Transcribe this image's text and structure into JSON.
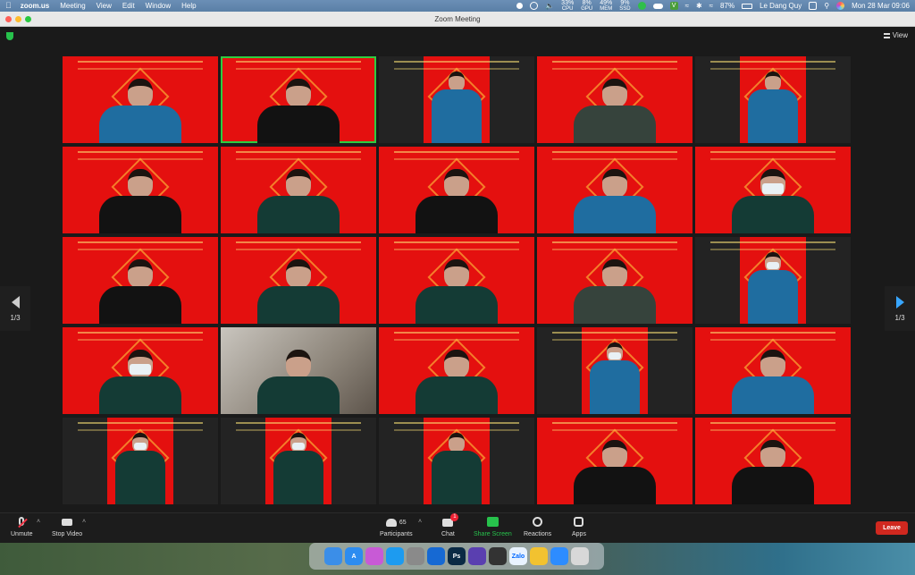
{
  "menubar": {
    "app_name": "zoom.us",
    "menus": [
      "Meeting",
      "View",
      "Edit",
      "Window",
      "Help"
    ],
    "stats": [
      {
        "value": "33%",
        "label": "CPU"
      },
      {
        "value": "8%",
        "label": "GPU"
      },
      {
        "value": "49%",
        "label": "MEM"
      },
      {
        "value": "9%",
        "label": "SSD"
      }
    ],
    "battery": "87%",
    "user": "Le Dang Quy",
    "datetime": "Mon 28 Mar  09:06"
  },
  "window": {
    "title": "Zoom Meeting"
  },
  "meeting": {
    "view_label": "View",
    "page_indicator_left": "1/3",
    "page_indicator_right": "1/3",
    "tiles": [
      {
        "bg": "red",
        "uniform": "blue",
        "layout": "full"
      },
      {
        "bg": "red",
        "uniform": "black",
        "layout": "full",
        "active": true
      },
      {
        "bg": "dark",
        "uniform": "blue",
        "layout": "narrow"
      },
      {
        "bg": "red",
        "uniform": "olive",
        "layout": "full"
      },
      {
        "bg": "dark",
        "uniform": "blue",
        "layout": "narrow"
      },
      {
        "bg": "red",
        "uniform": "black",
        "layout": "full"
      },
      {
        "bg": "red",
        "uniform": "dkgreen",
        "layout": "full"
      },
      {
        "bg": "red",
        "uniform": "black",
        "layout": "full"
      },
      {
        "bg": "red",
        "uniform": "blue",
        "layout": "full"
      },
      {
        "bg": "red",
        "uniform": "dkgreen",
        "layout": "full",
        "mask": true
      },
      {
        "bg": "red",
        "uniform": "black",
        "layout": "full"
      },
      {
        "bg": "red",
        "uniform": "dkgreen",
        "layout": "full"
      },
      {
        "bg": "red",
        "uniform": "dkgreen",
        "layout": "full"
      },
      {
        "bg": "red",
        "uniform": "olive",
        "layout": "full"
      },
      {
        "bg": "dark",
        "uniform": "blue",
        "layout": "narrow",
        "mask": true
      },
      {
        "bg": "red",
        "uniform": "dkgreen",
        "layout": "full",
        "mask": true
      },
      {
        "bg": "photo",
        "uniform": "dkgreen",
        "layout": "full"
      },
      {
        "bg": "red",
        "uniform": "dkgreen",
        "layout": "full"
      },
      {
        "bg": "dark",
        "uniform": "blue",
        "layout": "narrow",
        "mask": true
      },
      {
        "bg": "red",
        "uniform": "blue",
        "layout": "full"
      },
      {
        "bg": "dark",
        "uniform": "dkgreen",
        "layout": "narrow",
        "mask": true
      },
      {
        "bg": "dark",
        "uniform": "dkgreen",
        "layout": "narrow",
        "mask": true
      },
      {
        "bg": "dark",
        "uniform": "dkgreen",
        "layout": "narrow"
      },
      {
        "bg": "red",
        "uniform": "black",
        "layout": "full"
      },
      {
        "bg": "red",
        "uniform": "black",
        "layout": "full"
      }
    ]
  },
  "toolbar": {
    "unmute": "Unmute",
    "stop_video": "Stop Video",
    "participants": "Participants",
    "participants_count": "65",
    "chat": "Chat",
    "chat_badge": "1",
    "share_screen": "Share Screen",
    "reactions": "Reactions",
    "apps": "Apps",
    "leave": "Leave"
  },
  "dock": {
    "apps": [
      {
        "name": "finder-icon",
        "color": "#3b8ee8",
        "label": ""
      },
      {
        "name": "app-store-icon",
        "color": "#2d8cf0",
        "label": "A"
      },
      {
        "name": "launchpad-icon",
        "color": "#c85ad6",
        "label": ""
      },
      {
        "name": "safari-icon",
        "color": "#1d9bf0",
        "label": ""
      },
      {
        "name": "system-preferences-icon",
        "color": "#8a8a8a",
        "label": ""
      },
      {
        "name": "teamviewer-icon",
        "color": "#1669d3",
        "label": ""
      },
      {
        "name": "photoshop-icon",
        "color": "#0b2a44",
        "label": "Ps"
      },
      {
        "name": "imovie-icon",
        "color": "#5a3fb0",
        "label": ""
      },
      {
        "name": "davinci-icon",
        "color": "#333",
        "label": ""
      },
      {
        "name": "zalo-icon",
        "color": "#e9f3ff",
        "label": "Zalo"
      },
      {
        "name": "chrome-icon",
        "color": "#f2c230",
        "label": ""
      },
      {
        "name": "zoom-icon",
        "color": "#2d8cff",
        "label": ""
      },
      {
        "name": "trash-icon",
        "color": "#d8d8d8",
        "label": ""
      }
    ]
  }
}
